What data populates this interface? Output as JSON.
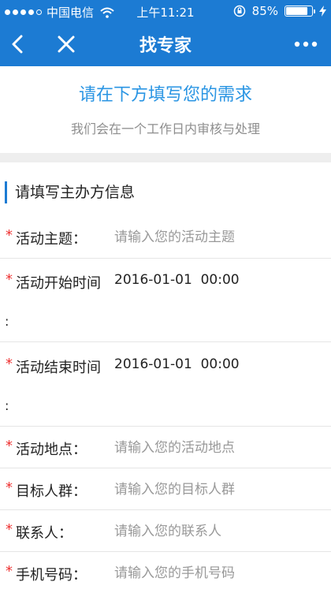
{
  "status_bar": {
    "carrier": "中国电信",
    "time": "上午11:21",
    "battery_percent": "85%",
    "battery_level": 0.85,
    "signal_bars_filled": 4,
    "signal_bars_total": 5
  },
  "nav": {
    "title": "找专家"
  },
  "intro": {
    "title": "请在下方填写您的需求",
    "subtitle": "我们会在一个工作日内审核与处理"
  },
  "section": {
    "title": "请填写主办方信息"
  },
  "fields": {
    "theme": {
      "required": "*",
      "label": "活动主题：",
      "placeholder": "请输入您的活动主题"
    },
    "start_time": {
      "required": "*",
      "label": "活动开始时间",
      "value": "2016-01-01  00:00",
      "colon": ":"
    },
    "end_time": {
      "required": "*",
      "label": "活动结束时间",
      "value": "2016-01-01  00:00",
      "colon": ":"
    },
    "location": {
      "required": "*",
      "label": "活动地点：",
      "placeholder": "请输入您的活动地点"
    },
    "audience": {
      "required": "*",
      "label": "目标人群：",
      "placeholder": "请输入您的目标人群"
    },
    "contact": {
      "required": "*",
      "label": "联系人：",
      "placeholder": "请输入您的联系人"
    },
    "phone": {
      "required": "*",
      "label": "手机号码：",
      "placeholder": "请输入您的手机号码"
    }
  },
  "colors": {
    "brand_blue": "#1c7bd3",
    "intro_title_blue": "#2a95e3",
    "required_red": "#e33333"
  },
  "icons": {
    "back": "chevron-left-icon",
    "close": "close-icon",
    "more": "more-horizontal-icon",
    "wifi": "wifi-icon",
    "lock_rotation": "rotation-lock-icon",
    "battery": "battery-icon",
    "charging": "charging-bolt-icon"
  }
}
